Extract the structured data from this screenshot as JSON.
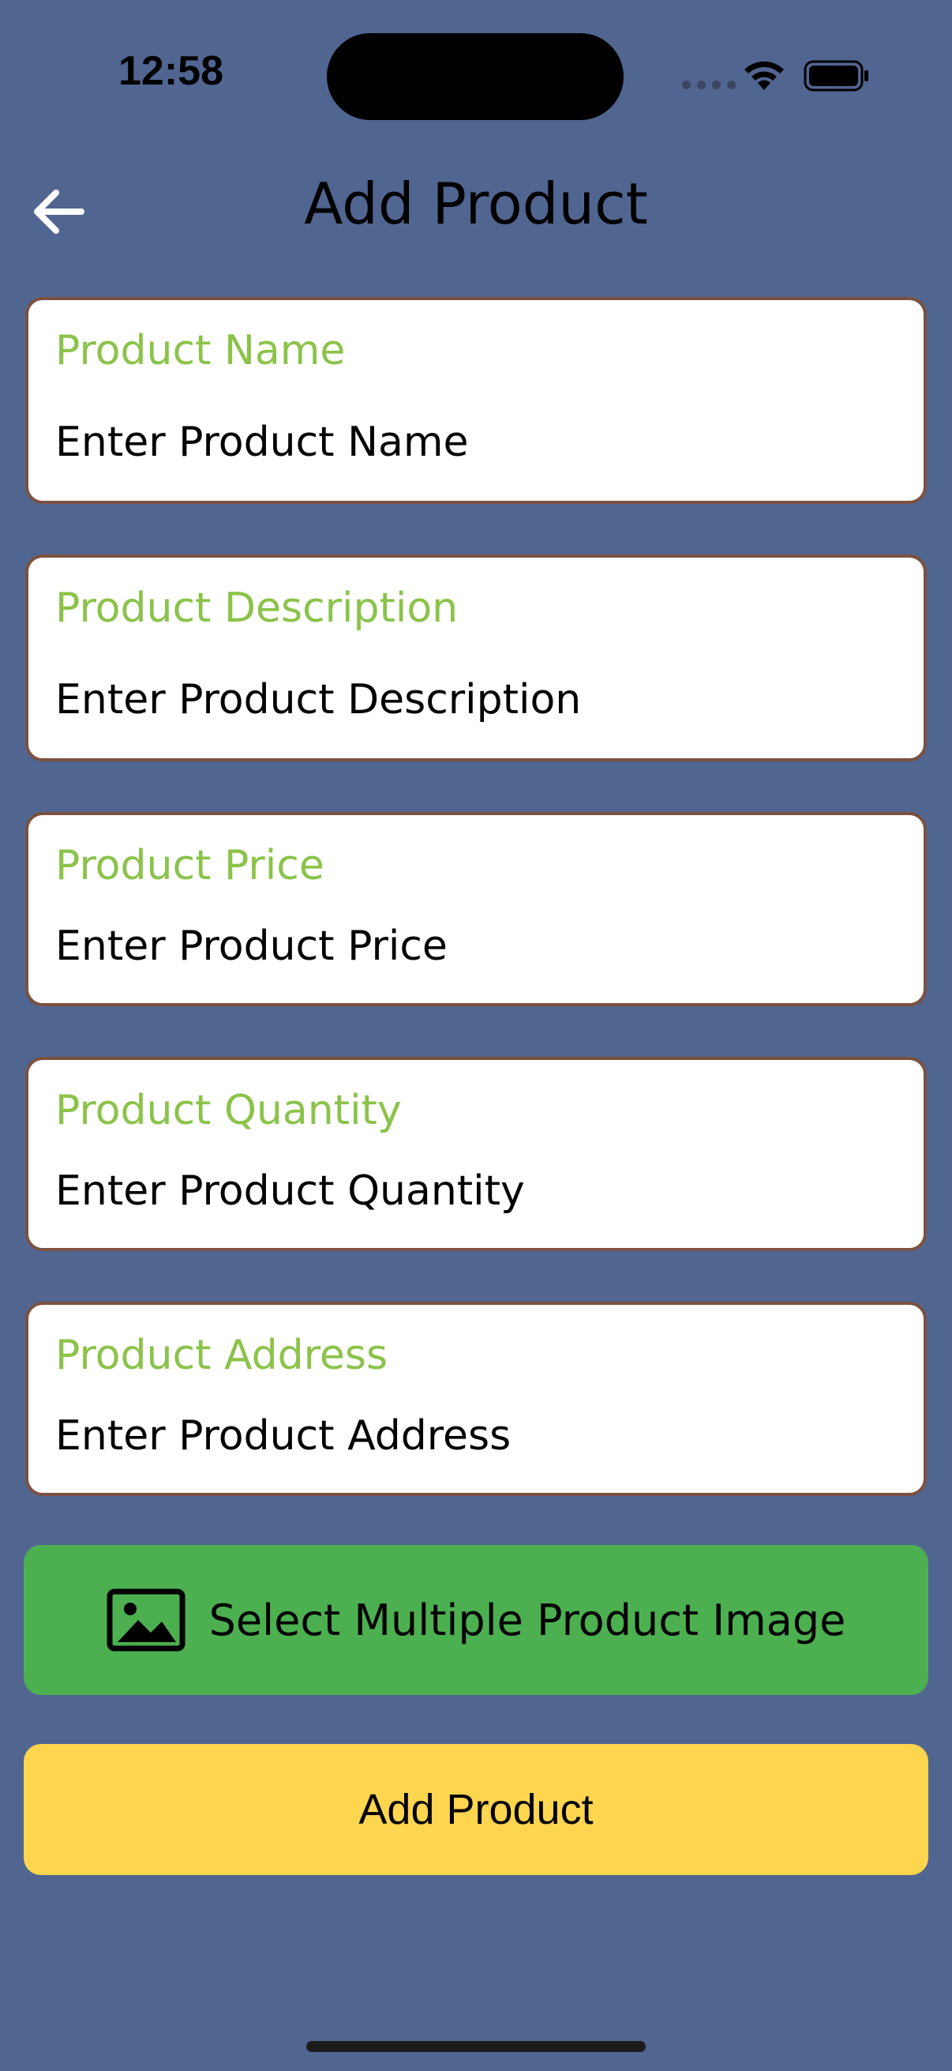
{
  "status_bar": {
    "time": "12:58",
    "icons": [
      "cellular-icon",
      "wifi-icon",
      "battery-icon"
    ]
  },
  "header": {
    "title": "Add Product",
    "back_icon": "arrow-left-icon"
  },
  "form": {
    "fields": [
      {
        "label": "Product Name",
        "placeholder": "Enter Product Name"
      },
      {
        "label": "Product Description",
        "placeholder": "Enter Product Description"
      },
      {
        "label": "Product Price",
        "placeholder": "Enter Product Price"
      },
      {
        "label": "Product Quantity",
        "placeholder": "Enter Product Quantity"
      },
      {
        "label": "Product Address",
        "placeholder": "Enter Product Address"
      }
    ]
  },
  "buttons": {
    "select_images_label": "Select Multiple Product Image",
    "select_images_icon": "image-icon",
    "add_product_label": "Add Product"
  },
  "colors": {
    "background": "#516591",
    "label_green": "#8bc34a",
    "field_border": "#7b5140",
    "image_button": "#4caf50",
    "add_button": "#fdd54f"
  }
}
